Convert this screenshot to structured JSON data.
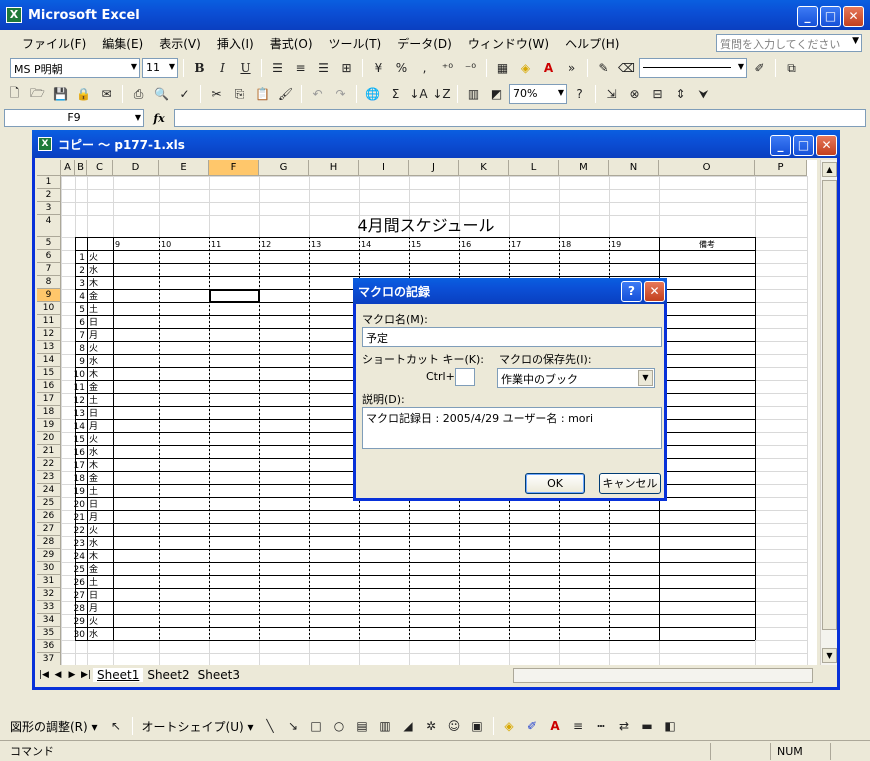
{
  "app_title": "Microsoft Excel",
  "window_controls": {
    "minimize": "_",
    "maximize": "□",
    "close": "✕"
  },
  "menu": [
    "ファイル(F)",
    "編集(E)",
    "表示(V)",
    "挿入(I)",
    "書式(O)",
    "ツール(T)",
    "データ(D)",
    "ウィンドウ(W)",
    "ヘルプ(H)"
  ],
  "help_search_placeholder": "質問を入力してください",
  "toolbar": {
    "font_name": "MS P明朝",
    "font_size": "11",
    "bold": "B",
    "italic": "I",
    "underline": "U",
    "percent": "%",
    "comma": ",",
    "sum": "Σ",
    "zoom": "70%"
  },
  "formula_bar": {
    "name_box": "F9",
    "fx": "fx",
    "value": ""
  },
  "workbook": {
    "title": "コピー ～ p177-1.xls",
    "columns": [
      "A",
      "B",
      "C",
      "D",
      "E",
      "F",
      "G",
      "H",
      "I",
      "J",
      "K",
      "L",
      "M",
      "N",
      "O",
      "P"
    ],
    "selected_column": "F",
    "selected_row": "9",
    "sheet_title": "4月間スケジュール",
    "hour_headers": [
      "9",
      "10",
      "11",
      "12",
      "13",
      "14",
      "15",
      "16",
      "17",
      "18",
      "19"
    ],
    "notes_header": "備考",
    "days": [
      {
        "d": "1",
        "w": "火"
      },
      {
        "d": "2",
        "w": "水"
      },
      {
        "d": "3",
        "w": "木"
      },
      {
        "d": "4",
        "w": "金"
      },
      {
        "d": "5",
        "w": "土"
      },
      {
        "d": "6",
        "w": "日"
      },
      {
        "d": "7",
        "w": "月"
      },
      {
        "d": "8",
        "w": "火"
      },
      {
        "d": "9",
        "w": "水"
      },
      {
        "d": "10",
        "w": "木"
      },
      {
        "d": "11",
        "w": "金"
      },
      {
        "d": "12",
        "w": "土"
      },
      {
        "d": "13",
        "w": "日"
      },
      {
        "d": "14",
        "w": "月"
      },
      {
        "d": "15",
        "w": "火"
      },
      {
        "d": "16",
        "w": "水"
      },
      {
        "d": "17",
        "w": "木"
      },
      {
        "d": "18",
        "w": "金"
      },
      {
        "d": "19",
        "w": "土"
      },
      {
        "d": "20",
        "w": "日"
      },
      {
        "d": "21",
        "w": "月"
      },
      {
        "d": "22",
        "w": "火"
      },
      {
        "d": "23",
        "w": "水"
      },
      {
        "d": "24",
        "w": "木"
      },
      {
        "d": "25",
        "w": "金"
      },
      {
        "d": "26",
        "w": "土"
      },
      {
        "d": "27",
        "w": "日"
      },
      {
        "d": "28",
        "w": "月"
      },
      {
        "d": "29",
        "w": "火"
      },
      {
        "d": "30",
        "w": "水"
      }
    ],
    "sheets": [
      "Sheet1",
      "Sheet2",
      "Sheet3"
    ],
    "active_sheet": "Sheet1"
  },
  "dialog": {
    "title": "マクロの記録",
    "help": "?",
    "macro_name_label": "マクロ名(M):",
    "macro_name_value": "予定",
    "shortcut_label": "ショートカット キー(K):",
    "ctrl_label": "Ctrl+",
    "shortcut_value": "",
    "store_label": "マクロの保存先(I):",
    "store_value": "作業中のブック",
    "description_label": "説明(D):",
    "description_value": "マクロ記録日 : 2005/4/29  ユーザー名 : mori",
    "ok": "OK",
    "cancel": "キャンセル"
  },
  "drawing_toolbar": {
    "draw_menu": "図形の調整(R) ▾",
    "autoshape": "オートシェイプ(U) ▾"
  },
  "status": {
    "mode": "コマンド",
    "num": "NUM"
  }
}
